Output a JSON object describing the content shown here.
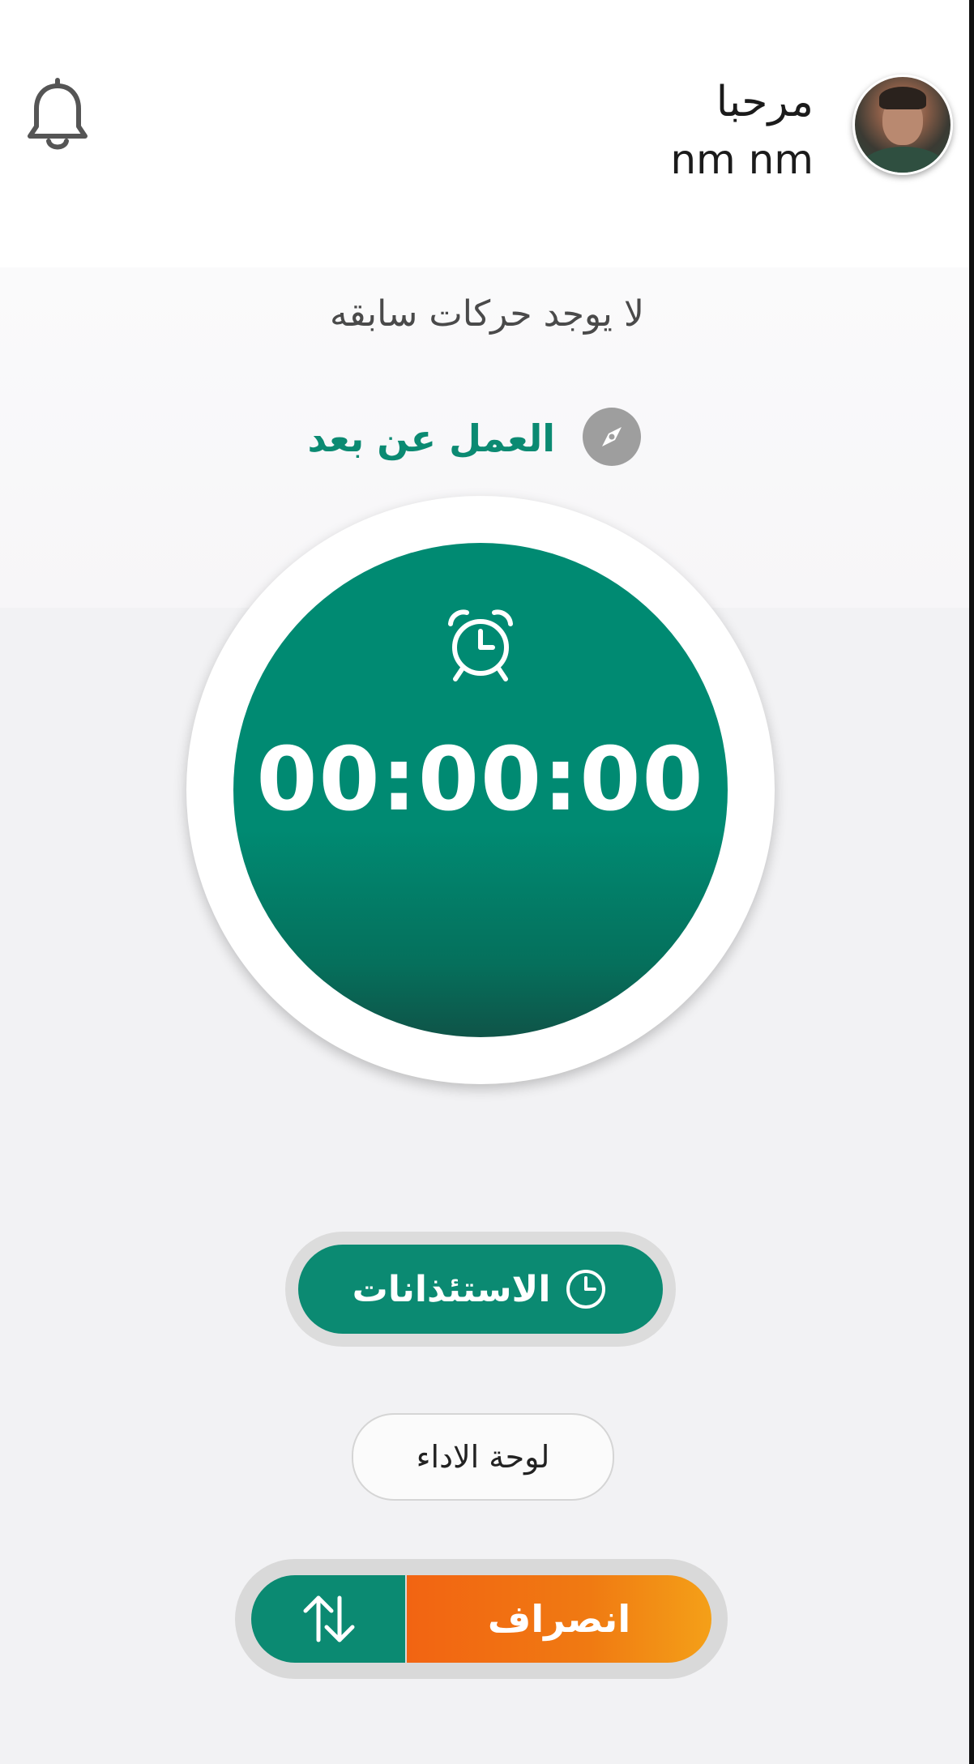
{
  "header": {
    "greeting": "مرحبا",
    "username": "nm nm"
  },
  "status": {
    "no_moves": "لا يوجد حركات سابقه"
  },
  "work_mode": {
    "label": "العمل عن بعد"
  },
  "timer": {
    "value": "00:00:00"
  },
  "actions": {
    "permissions_label": "الاستئذانات",
    "dashboard_label": "لوحة الاداء",
    "leave_label": "انصراف"
  },
  "colors": {
    "primary": "#0b8a72",
    "leave": "#f26412"
  },
  "icons": {
    "notifications": "bell-icon",
    "work_mode": "compass-icon",
    "timer": "alarm-clock-icon",
    "permissions": "clock-icon",
    "switch": "swap-arrows-icon"
  }
}
